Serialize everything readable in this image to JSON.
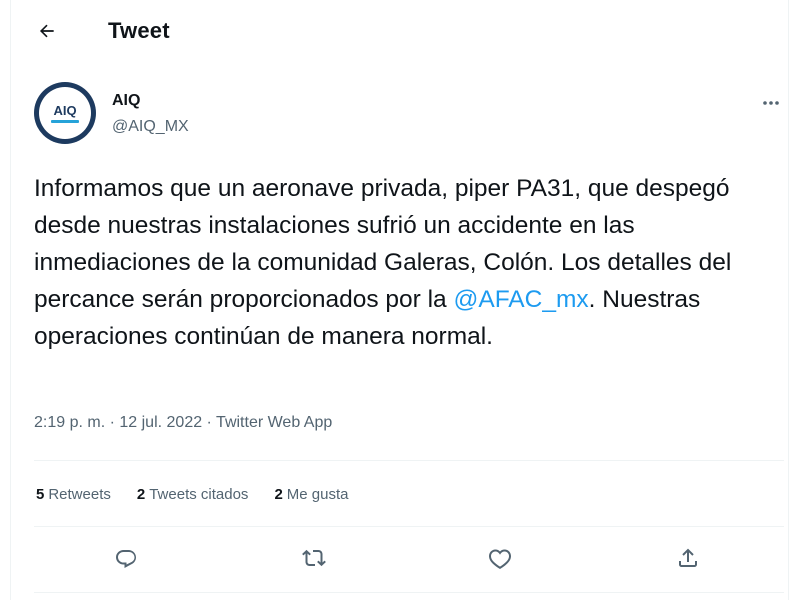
{
  "header": {
    "title": "Tweet"
  },
  "author": {
    "display_name": "AIQ",
    "handle": "@AIQ_MX",
    "avatar_text": "AIQ"
  },
  "tweet": {
    "text_before": "Informamos que un aeronave privada, piper PA31, que despegó desde nuestras instalaciones sufrió un accidente en las inmediaciones de la comunidad Galeras, Colón. Los detalles del percance serán proporcionados por la ",
    "mention": "@AFAC_mx",
    "text_after": ". Nuestras operaciones continúan de manera normal."
  },
  "meta": {
    "time": "2:19 p. m.",
    "separator1": " · ",
    "date": "12 jul. 2022",
    "separator2": " · ",
    "source": "Twitter Web App"
  },
  "stats": {
    "retweets_count": "5",
    "retweets_label": "Retweets",
    "quotes_count": "2",
    "quotes_label": "Tweets citados",
    "likes_count": "2",
    "likes_label": "Me gusta"
  },
  "icons": {
    "back": "arrow-left-icon",
    "more": "more-icon",
    "reply": "reply-icon",
    "retweet": "retweet-icon",
    "like": "heart-icon",
    "share": "share-icon"
  },
  "colors": {
    "accent": "#1d9bf0",
    "text": "#0f1419",
    "secondary": "#536471",
    "border": "#eff3f4",
    "avatar_ring": "#1d3a5f"
  }
}
